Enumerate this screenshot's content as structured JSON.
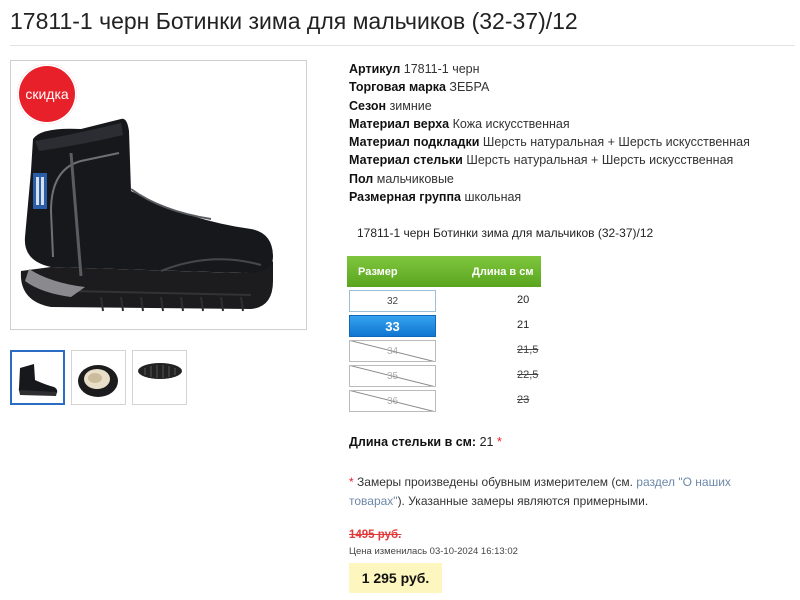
{
  "product": {
    "title": "17811-1 черн Ботинки зима для мальчиков (32-37)/12",
    "sale_badge": "скидка",
    "short_name": "17811-1 черн Ботинки зима для мальчиков (32-37)/12"
  },
  "specs": [
    {
      "key": "Артикул",
      "value": "17811-1 черн"
    },
    {
      "key": "Торговая марка",
      "value": "ЗЕБРА"
    },
    {
      "key": "Сезон",
      "value": "зимние"
    },
    {
      "key": "Материал верха",
      "value": "Кожа искусственная"
    },
    {
      "key": "Материал подкладки",
      "value": "Шерсть натуральная + Шерсть искусственная"
    },
    {
      "key": "Материал стельки",
      "value": "Шерсть натуральная + Шерсть искусственная"
    },
    {
      "key": "Пол",
      "value": "мальчиковые"
    },
    {
      "key": "Размерная группа",
      "value": "школьная"
    }
  ],
  "size_table": {
    "header_size": "Размер",
    "header_length": "Длина в см",
    "rows": [
      {
        "size": "32",
        "length": "20"
      },
      {
        "size": "33",
        "length": "21"
      },
      {
        "size": "34",
        "length": "21,5"
      },
      {
        "size": "35",
        "length": "22,5"
      },
      {
        "size": "36",
        "length": "23"
      }
    ]
  },
  "insole": {
    "label": "Длина стельки в см:",
    "value": "21",
    "asterisk": "*"
  },
  "note": {
    "asterisk": "*",
    "text_before": "Замеры произведены обувным измерителем (см.",
    "link": "раздел \"О наших товарах\"",
    "text_after": "). Указанные замеры являются примерными."
  },
  "price": {
    "old": "1495 руб.",
    "changed": "Цена изменилась 03-10-2024 16:13:02",
    "current": "1 295 руб."
  },
  "colors": {
    "sale_red": "#e8202a",
    "header_green": "#6bb52d",
    "selected_blue": "#1a8ae2",
    "price_bg": "#fef6bf"
  }
}
